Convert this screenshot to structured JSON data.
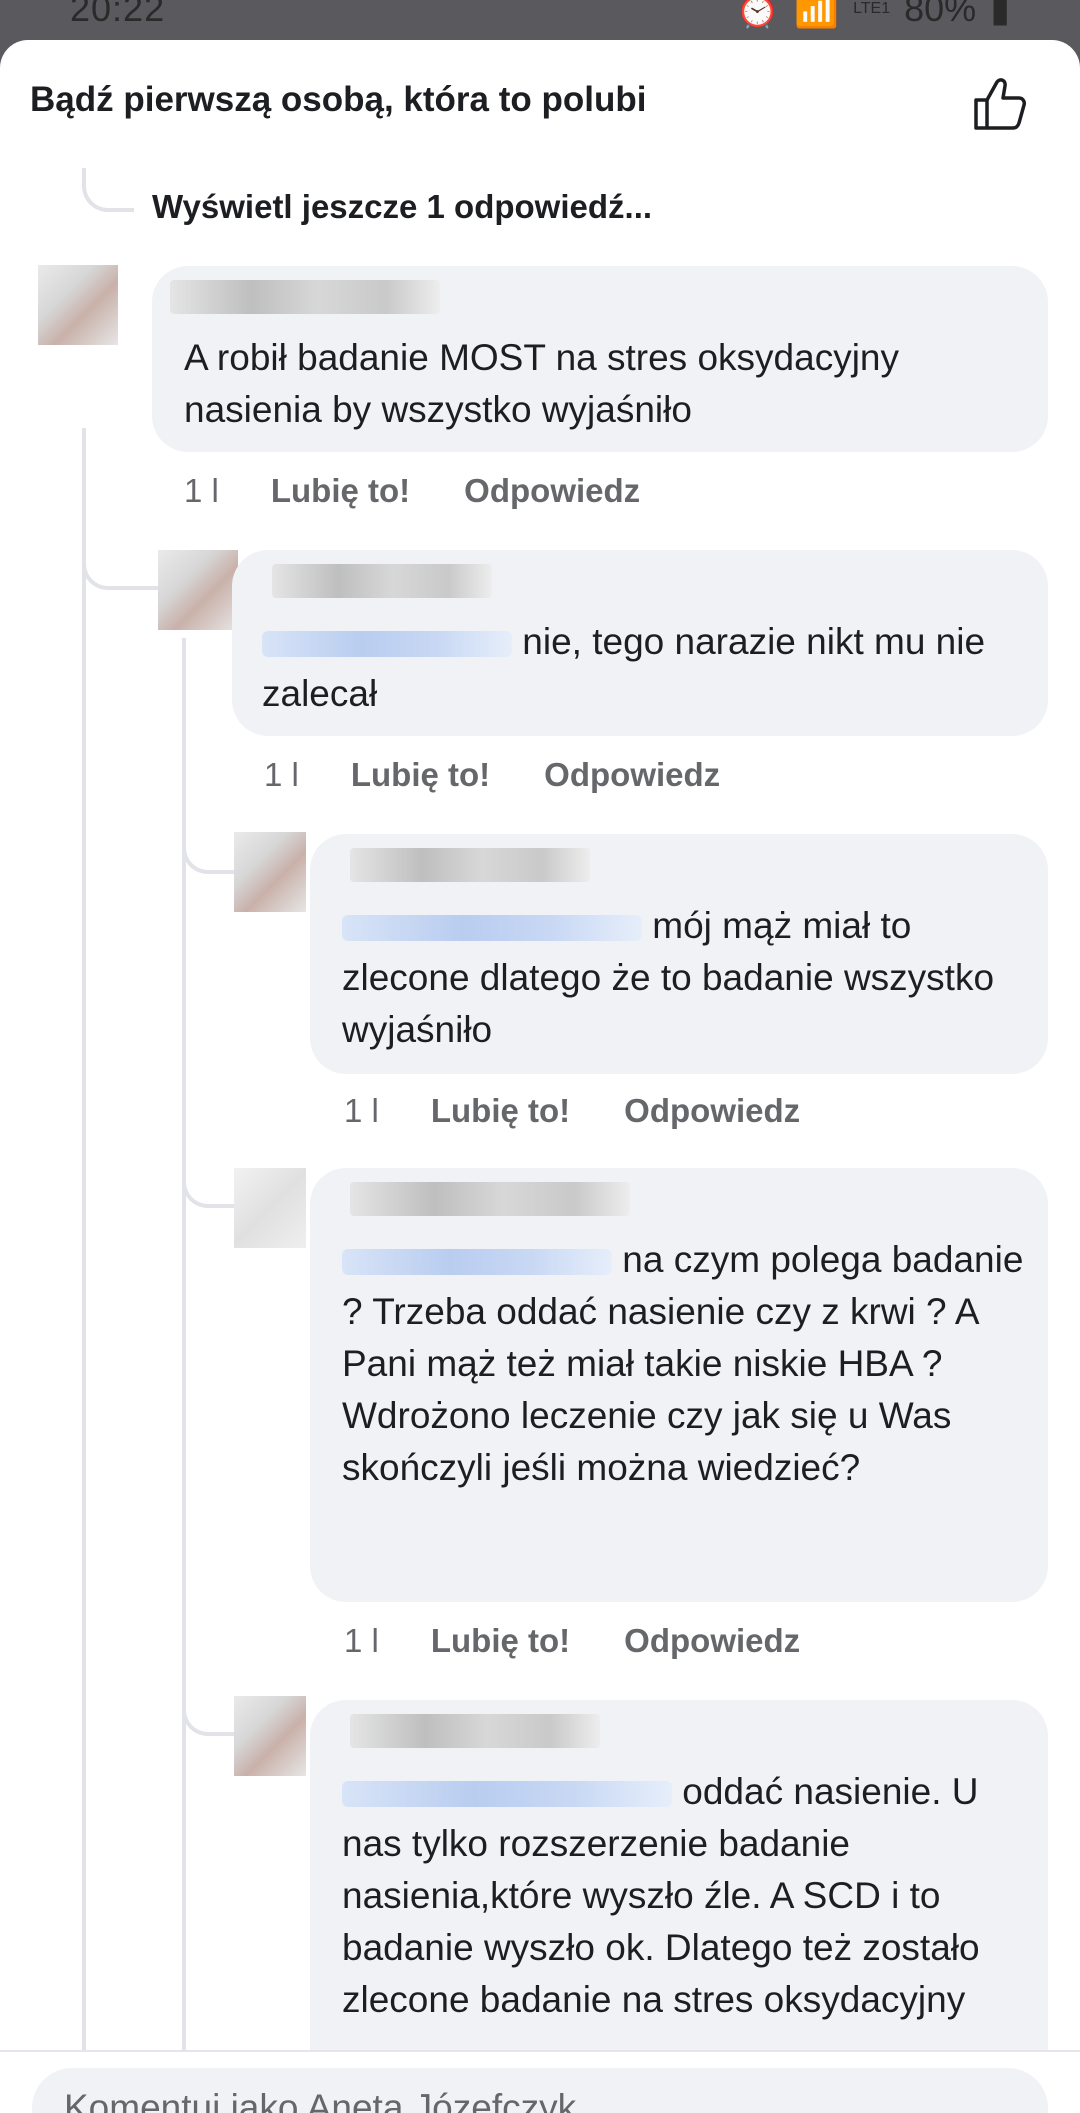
{
  "status_bar": {
    "time": "20:22",
    "battery": "80%",
    "network": "LTE1"
  },
  "header": {
    "title": "Bądź pierwszą osobą, która to polubi"
  },
  "thread": {
    "more_replies": "Wyświetl jeszcze 1 odpowiedź..."
  },
  "comments": [
    {
      "text": "A robił badanie MOST na stres oksydacyjny nasienia by wszystko wyjaśniło",
      "time": "1 l",
      "like": "Lubię to!",
      "reply": "Odpowiedz"
    },
    {
      "text": "nie, tego narazie nikt mu nie zalecał",
      "time": "1 l",
      "like": "Lubię to!",
      "reply": "Odpowiedz"
    },
    {
      "text": "mój mąż miał to zlecone dlatego że to badanie wszystko wyjaśniło",
      "time": "1 l",
      "like": "Lubię to!",
      "reply": "Odpowiedz"
    },
    {
      "text": "na czym polega badanie ? Trzeba oddać nasienie czy z krwi ? A Pani mąż też miał takie niskie HBA ? Wdrożono leczenie czy jak się u Was skończyli jeśli można wiedzieć?",
      "time": "1 l",
      "like": "Lubię to!",
      "reply": "Odpowiedz"
    },
    {
      "text": "oddać nasienie. U nas tylko rozszerzenie badanie nasienia,które wyszło źle. A SCD i to badanie wyszło ok. Dlatego też zostało zlecone badanie na stres oksydacyjny"
    }
  ],
  "composer": {
    "placeholder": "Komentuj jako Aneta Józefczyk"
  }
}
